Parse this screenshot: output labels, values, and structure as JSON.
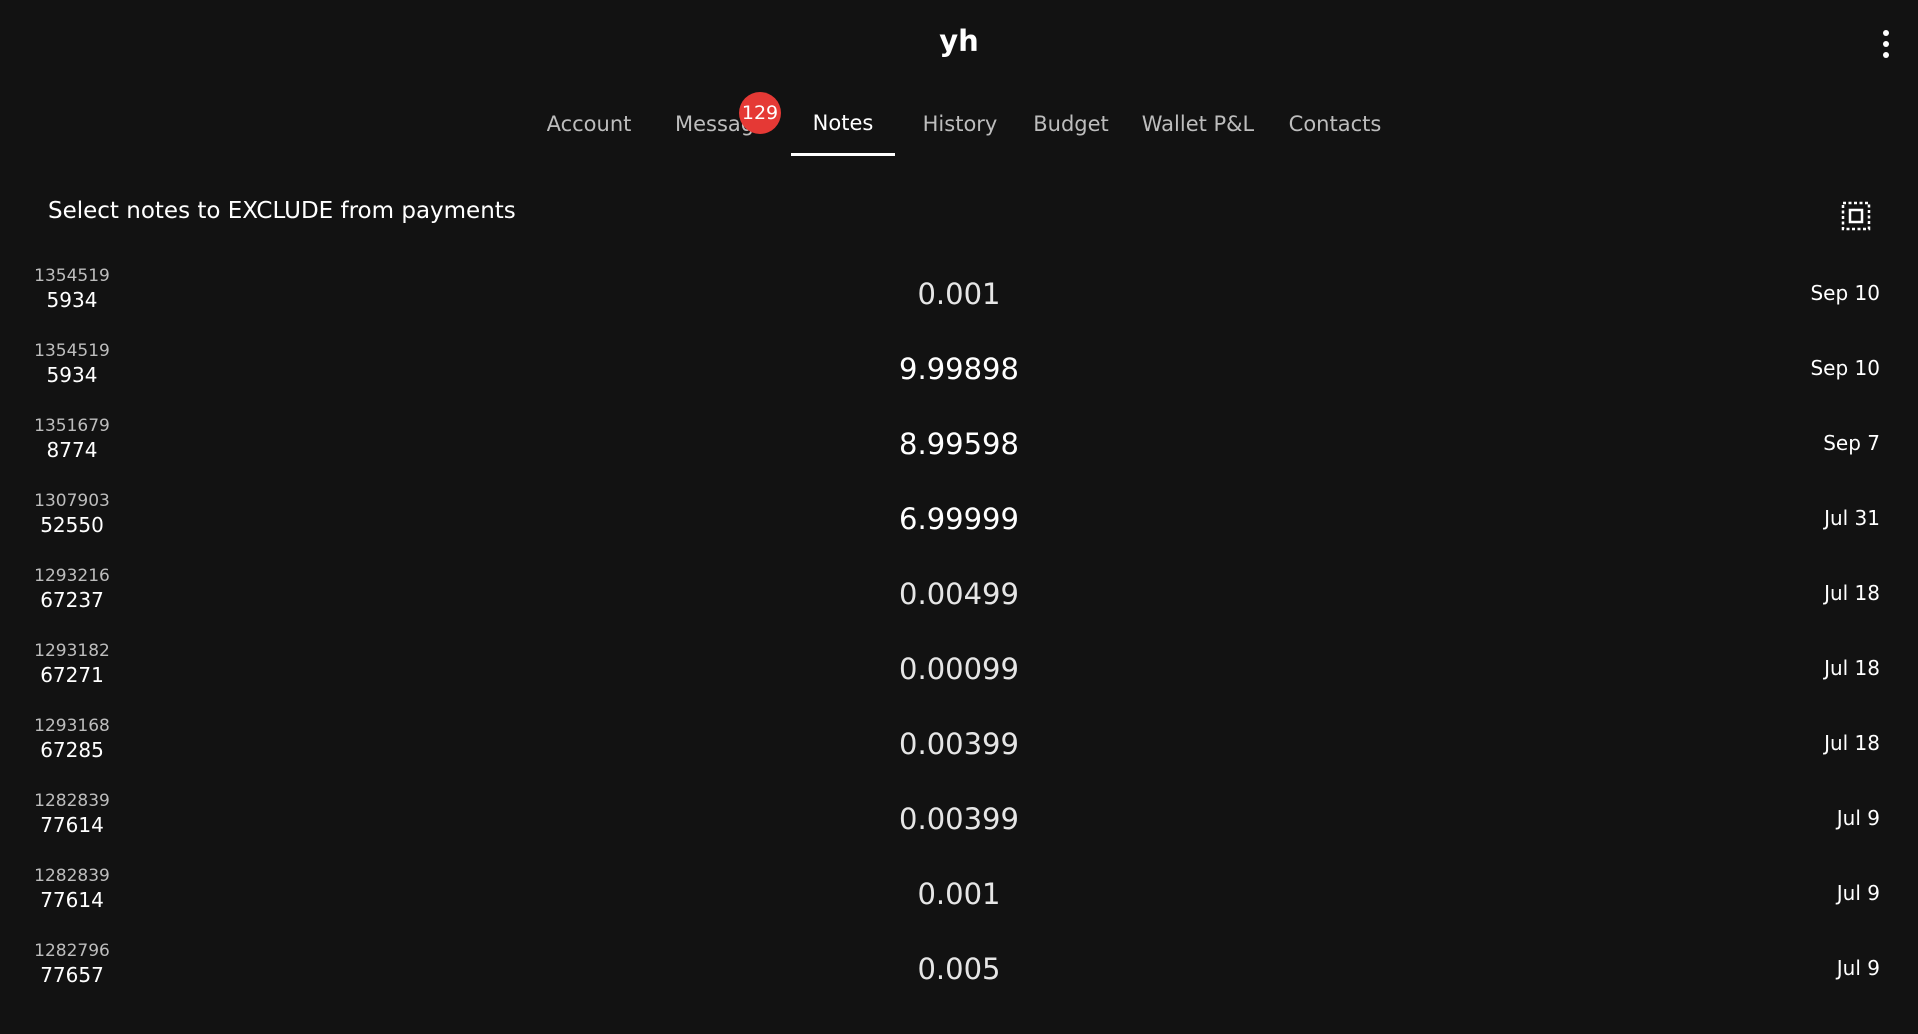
{
  "header": {
    "title": "yh",
    "menu_icon": "more-vert-icon"
  },
  "tabs": [
    {
      "label": "Account",
      "active": false
    },
    {
      "label": "Messag",
      "active": false,
      "badge": "129"
    },
    {
      "label": "Notes",
      "active": true
    },
    {
      "label": "History",
      "active": false
    },
    {
      "label": "Budget",
      "active": false
    },
    {
      "label": "Wallet P&L",
      "active": false
    },
    {
      "label": "Contacts",
      "active": false
    }
  ],
  "notes": {
    "header": "Select notes to EXCLUDE from payments",
    "select_all_icon": "select-all-icon",
    "rows": [
      {
        "id_top": "1354519",
        "id_bottom": "5934",
        "amount": "0.001",
        "date": "Sep 10"
      },
      {
        "id_top": "1354519",
        "id_bottom": "5934",
        "amount": "9.99898",
        "date": "Sep 10"
      },
      {
        "id_top": "1351679",
        "id_bottom": "8774",
        "amount": "8.99598",
        "date": "Sep 7"
      },
      {
        "id_top": "1307903",
        "id_bottom": "52550",
        "amount": "6.99999",
        "date": "Jul 31"
      },
      {
        "id_top": "1293216",
        "id_bottom": "67237",
        "amount": "0.00499",
        "date": "Jul 18"
      },
      {
        "id_top": "1293182",
        "id_bottom": "67271",
        "amount": "0.00099",
        "date": "Jul 18"
      },
      {
        "id_top": "1293168",
        "id_bottom": "67285",
        "amount": "0.00399",
        "date": "Jul 18"
      },
      {
        "id_top": "1282839",
        "id_bottom": "77614",
        "amount": "0.00399",
        "date": "Jul 9"
      },
      {
        "id_top": "1282839",
        "id_bottom": "77614",
        "amount": "0.001",
        "date": "Jul 9"
      },
      {
        "id_top": "1282796",
        "id_bottom": "77657",
        "amount": "0.005",
        "date": "Jul 9"
      }
    ]
  },
  "colors": {
    "background": "#121212",
    "badge": "#e53935",
    "text": "#ffffff",
    "muted_text": "#bdbdbd"
  }
}
